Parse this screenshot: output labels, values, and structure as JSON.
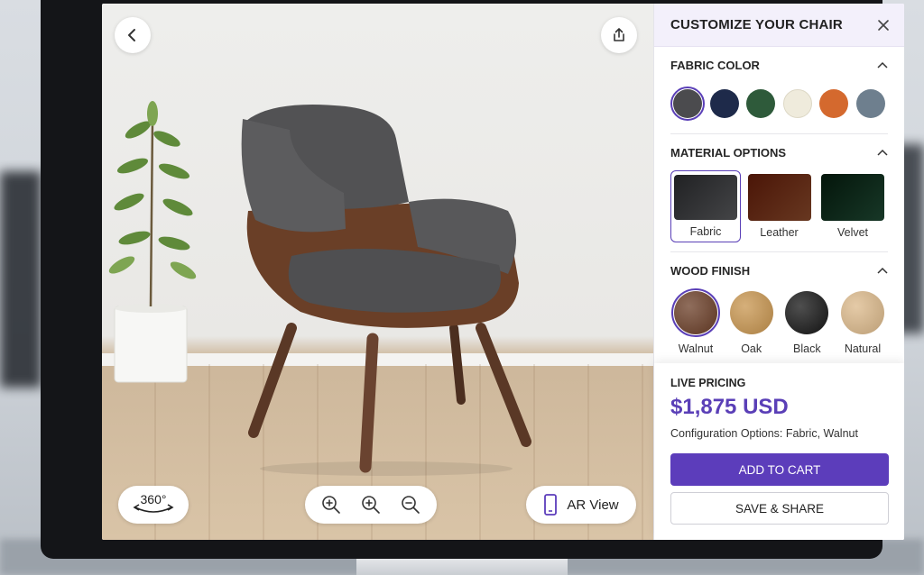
{
  "viewer": {
    "view360_label": "360°",
    "ar_label": "AR View"
  },
  "panel": {
    "title": "CUSTOMIZE YOUR CHAIR",
    "fabric": {
      "heading": "FABRIC COLOR",
      "colors": [
        "#4b4b4e",
        "#1e2a4a",
        "#2e5a3a",
        "#efebdc",
        "#d4692e",
        "#6e7f8e"
      ],
      "selected_index": 0
    },
    "material": {
      "heading": "MATERIAL OPTIONS",
      "options": [
        {
          "label": "Fabric",
          "color": "#5b5c5f"
        },
        {
          "label": "Leather",
          "color": "#8a4a2b"
        },
        {
          "label": "Velvet",
          "color": "#1f4a34"
        }
      ],
      "selected_index": 0
    },
    "wood": {
      "heading": "WOOD FINISH",
      "options": [
        {
          "label": "Walnut",
          "color": "#6a3d26"
        },
        {
          "label": "Oak",
          "color": "#c8954e"
        },
        {
          "label": "Black",
          "color": "#141414"
        },
        {
          "label": "Natural",
          "color": "#dcb98a"
        }
      ],
      "selected_index": 0
    }
  },
  "pricing": {
    "label": "LIVE PRICING",
    "price": "$1,875 USD",
    "config": "Configuration Options: Fabric, Walnut",
    "add_to_cart": "ADD TO CART",
    "save_share": "SAVE & SHARE"
  },
  "colors": {
    "accent": "#5c3dbb"
  }
}
